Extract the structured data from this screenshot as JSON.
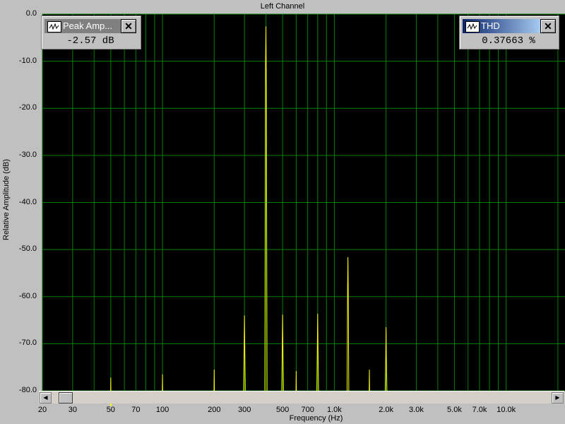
{
  "window": {
    "title": "Left Channel"
  },
  "chart_data": {
    "type": "line",
    "title": "Left Channel",
    "xlabel": "Frequency (Hz)",
    "ylabel": "Relative Amplitude (dB)",
    "xscale": "log",
    "xlim": [
      20,
      22000
    ],
    "ylim": [
      -80,
      0
    ],
    "grid": true,
    "y_ticks": [
      "0.0",
      "-10.0",
      "-20.0",
      "-30.0",
      "-40.0",
      "-50.0",
      "-60.0",
      "-70.0",
      "-80.0"
    ],
    "x_ticks": [
      {
        "value": 20,
        "label": "20"
      },
      {
        "value": 30,
        "label": "30"
      },
      {
        "value": 50,
        "label": "50"
      },
      {
        "value": 70,
        "label": "70"
      },
      {
        "value": 100,
        "label": "100"
      },
      {
        "value": 200,
        "label": "200"
      },
      {
        "value": 300,
        "label": "300"
      },
      {
        "value": 500,
        "label": "500"
      },
      {
        "value": 700,
        "label": "700"
      },
      {
        "value": 1000,
        "label": "1.0k"
      },
      {
        "value": 2000,
        "label": "2.0k"
      },
      {
        "value": 3000,
        "label": "3.0k"
      },
      {
        "value": 5000,
        "label": "5.0k"
      },
      {
        "value": 7000,
        "label": "7.0k"
      },
      {
        "value": 10000,
        "label": "10.0k"
      }
    ],
    "grid_x": [
      20,
      30,
      40,
      50,
      60,
      70,
      80,
      90,
      100,
      200,
      300,
      400,
      500,
      600,
      700,
      800,
      900,
      1000,
      2000,
      3000,
      4000,
      5000,
      6000,
      7000,
      8000,
      9000,
      10000,
      20000
    ],
    "series": [
      {
        "color": "#ffff00",
        "peaks": [
          {
            "f": 50,
            "db": -77.2
          },
          {
            "f": 100,
            "db": -76.5
          },
          {
            "f": 200,
            "db": -75.5
          },
          {
            "f": 300,
            "db": -64.0
          },
          {
            "f": 400,
            "db": -2.6
          },
          {
            "f": 500,
            "db": -63.8
          },
          {
            "f": 600,
            "db": -75.8
          },
          {
            "f": 800,
            "db": -63.6
          },
          {
            "f": 1200,
            "db": -51.6
          },
          {
            "f": 1600,
            "db": -75.5
          },
          {
            "f": 2000,
            "db": -66.5
          }
        ]
      }
    ]
  },
  "meters": [
    {
      "name": "Peak Amp...",
      "value": "-2.57 dB",
      "icon": "waveform-icon"
    },
    {
      "name": "THD",
      "value": "0.37663 %",
      "icon": "waveform-icon"
    }
  ],
  "colors": {
    "plot_bg": "#000000",
    "grid": "#008000",
    "trace": "#ffff00",
    "panel": "#c0c0c0"
  }
}
